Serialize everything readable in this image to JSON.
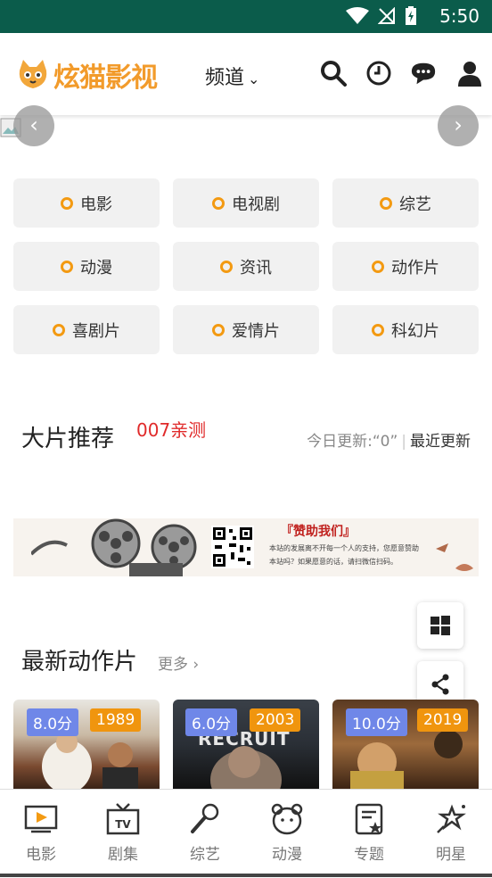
{
  "status": {
    "time": "5:50"
  },
  "app": {
    "logo_text": "炫猫影视",
    "channel_label": "频道"
  },
  "toolbar": {
    "icons": [
      "search-icon",
      "history-icon",
      "message-icon",
      "user-icon"
    ]
  },
  "categories": [
    {
      "label": "电影"
    },
    {
      "label": "电视剧"
    },
    {
      "label": "综艺"
    },
    {
      "label": "动漫"
    },
    {
      "label": "资讯"
    },
    {
      "label": "动作片"
    },
    {
      "label": "喜剧片"
    },
    {
      "label": "爱情片"
    },
    {
      "label": "科幻片"
    }
  ],
  "featured": {
    "title": "大片推荐",
    "tag": "007亲测",
    "update_label": "今日更新:“0”",
    "recent_label": "最近更新"
  },
  "ad": {
    "title": "『赞助我们』",
    "line1": "本站的发展离不开每一个人的支持，您愿意赞助",
    "line2": "本站吗？如果愿意的话，请扫微信扫码。"
  },
  "action_section": {
    "title": "最新动作片",
    "more_label": "更多"
  },
  "posters": [
    {
      "score": "8.0分",
      "year": "1989"
    },
    {
      "score": "6.0分",
      "year": "2003",
      "poster_text": "RECRUIT"
    },
    {
      "score": "10.0分",
      "year": "2019"
    }
  ],
  "tabs": [
    {
      "label": "电影",
      "icon": "movie-icon"
    },
    {
      "label": "剧集",
      "icon": "tv-icon"
    },
    {
      "label": "综艺",
      "icon": "microphone-icon"
    },
    {
      "label": "动漫",
      "icon": "bear-icon"
    },
    {
      "label": "专题",
      "icon": "topic-icon"
    },
    {
      "label": "明星",
      "icon": "star-icon"
    }
  ],
  "colors": {
    "status_bar": "#0b5c4b",
    "accent": "#f39a12",
    "score_badge": "#6f87e8",
    "year_badge": "#f0950e",
    "tag_red": "#e02a2a"
  }
}
